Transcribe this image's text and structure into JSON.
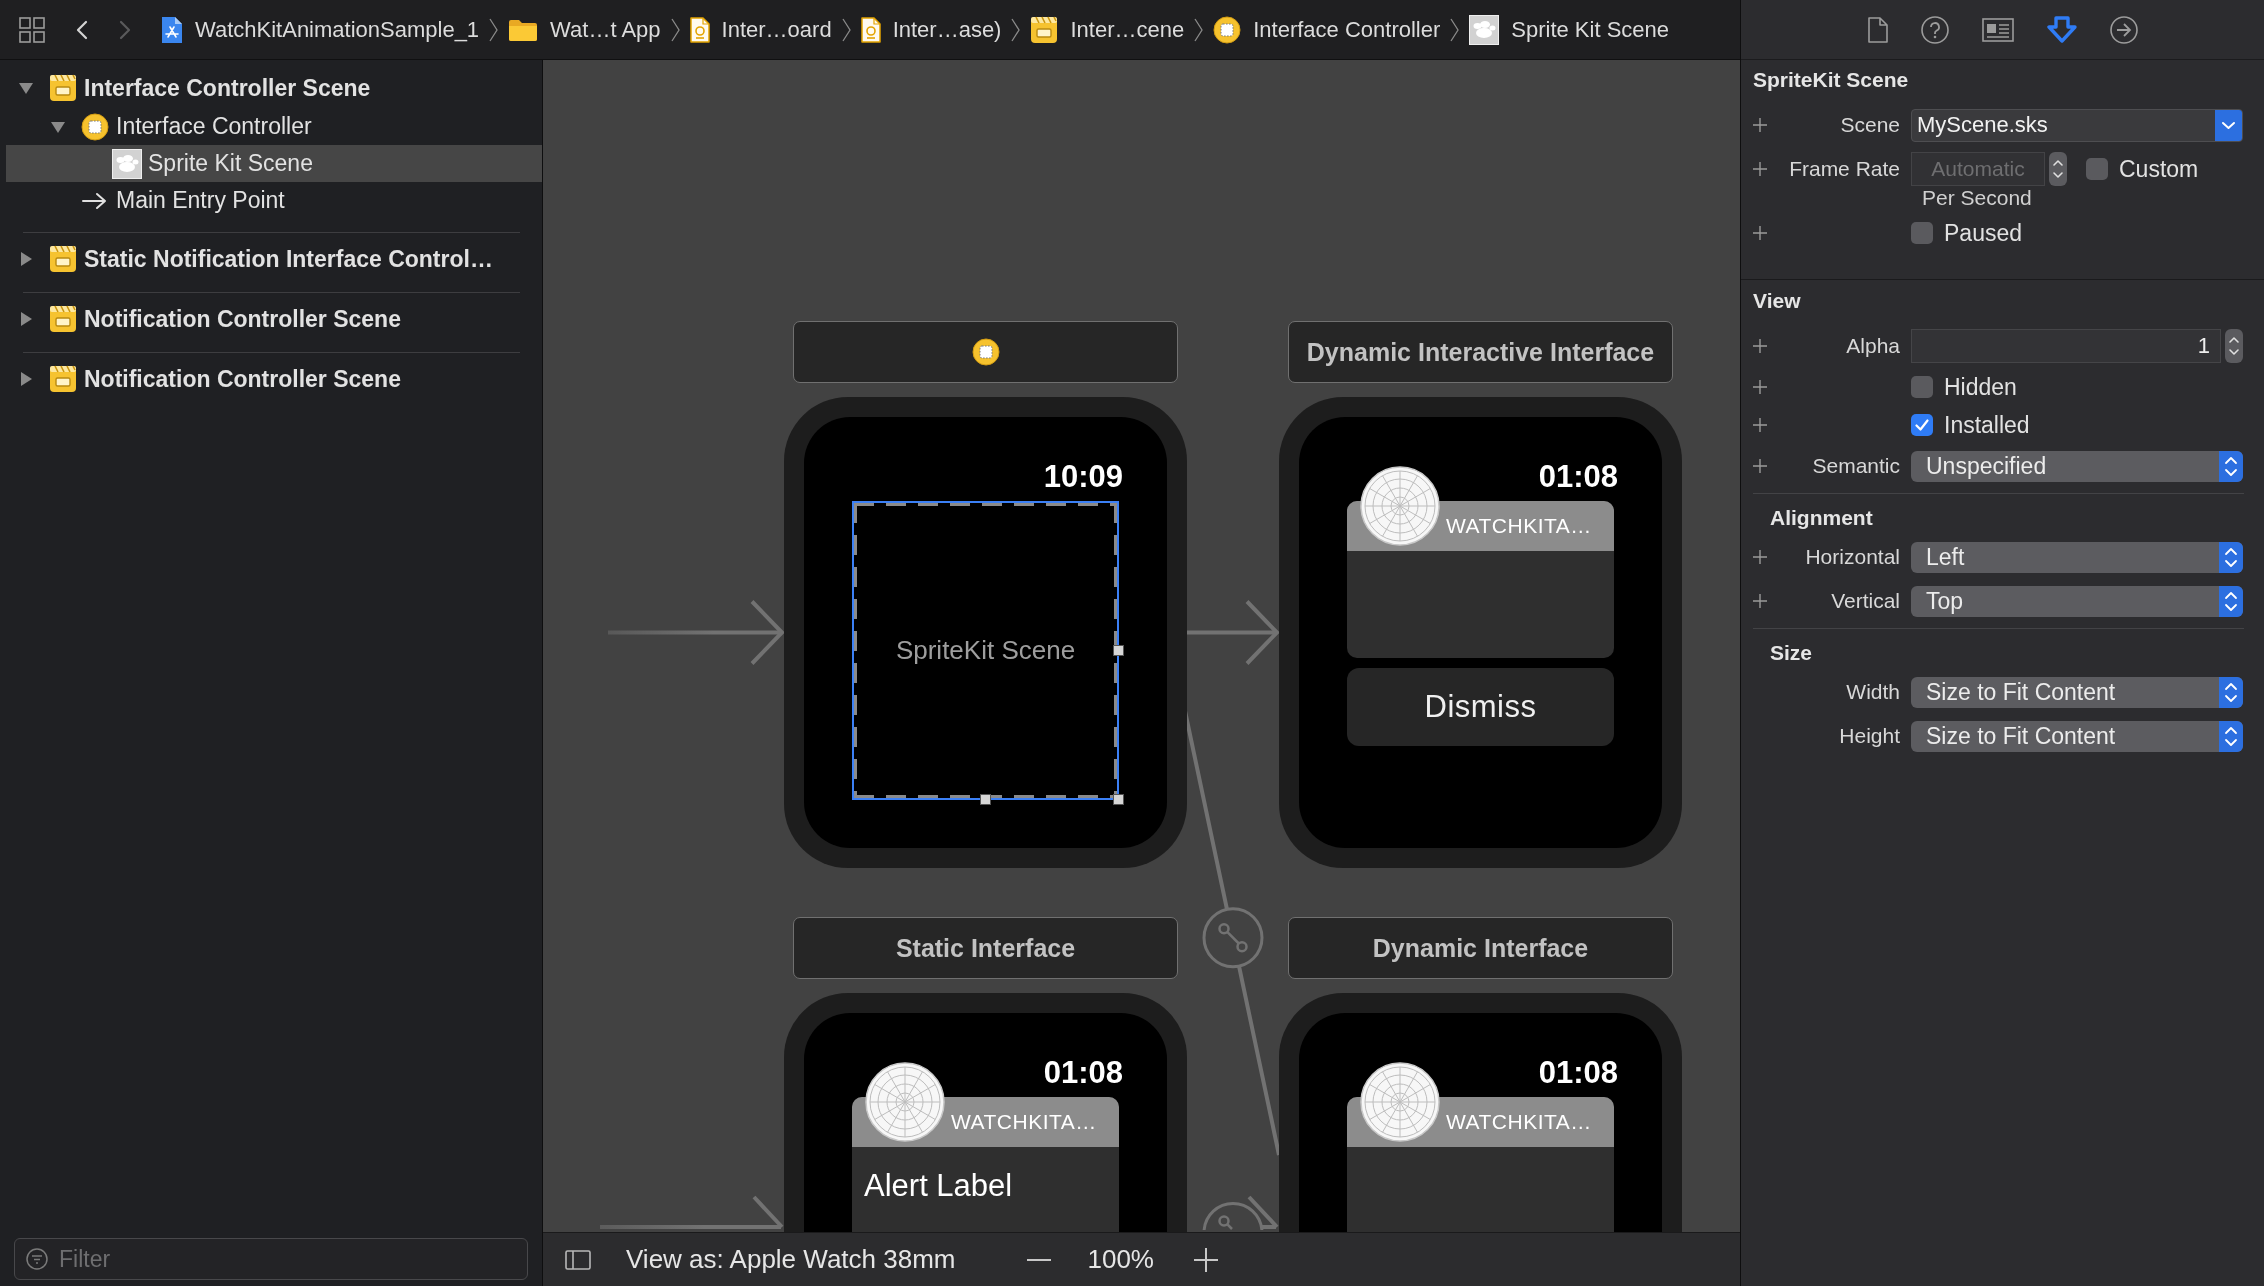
{
  "toolbar": {
    "history": [
      {
        "kind": "back",
        "disabled": false
      },
      {
        "kind": "forward",
        "disabled": true
      }
    ],
    "breadcrumbs": [
      {
        "kind": "project",
        "label": "WatchKitAnimationSample_1"
      },
      {
        "kind": "folder",
        "label": "Wat…t App"
      },
      {
        "kind": "storyboard",
        "label": "Inter…oard"
      },
      {
        "kind": "storyboard",
        "label": "Inter…ase)"
      },
      {
        "kind": "scene",
        "label": "Inter…cene"
      },
      {
        "kind": "controller",
        "label": "Interface Controller"
      },
      {
        "kind": "sprite",
        "label": "Sprite Kit Scene"
      }
    ]
  },
  "navigator": {
    "outline": [
      {
        "kind": "scene",
        "label": "Interface Controller Scene",
        "expanded": true,
        "selected": false,
        "children": [
          {
            "kind": "controller",
            "label": "Interface Controller",
            "expanded": true,
            "selected": false,
            "children": [
              {
                "kind": "sprite",
                "label": "Sprite Kit Scene",
                "selected": true
              }
            ]
          },
          {
            "kind": "entry",
            "label": "Main Entry Point",
            "selected": false
          }
        ]
      },
      {
        "kind": "scene",
        "label": "Static Notification Interface Control…",
        "expanded": false,
        "selected": false
      },
      {
        "kind": "scene",
        "label": "Notification Controller Scene",
        "expanded": false,
        "selected": false
      },
      {
        "kind": "scene",
        "label": "Notification Controller Scene",
        "expanded": false,
        "selected": false
      }
    ],
    "filter": {
      "placeholder": "Filter"
    }
  },
  "canvas": {
    "scenes": [
      {
        "kind": "sprite",
        "time": "10:09",
        "content_label": "SpriteKit Scene",
        "selected": true
      },
      {
        "kind": "notification",
        "title": "Dynamic Interactive Interface",
        "time": "01:08",
        "app_name": "WATCHKITA…",
        "button": "Dismiss"
      },
      {
        "kind": "notification",
        "title": "Static Interface",
        "time": "01:08",
        "app_name": "WATCHKITA…",
        "body": "Alert Label"
      },
      {
        "kind": "notification",
        "title": "Dynamic Interface",
        "time": "01:08",
        "app_name": "WATCHKITA…"
      }
    ],
    "bottom_bar": {
      "device_label": "View as: Apple Watch 38mm",
      "zoom": "100%"
    }
  },
  "inspector": {
    "tabs": [
      {
        "kind": "file",
        "selected": false
      },
      {
        "kind": "help",
        "selected": false
      },
      {
        "kind": "identity",
        "selected": false
      },
      {
        "kind": "attributes",
        "selected": true
      },
      {
        "kind": "connections",
        "selected": false
      }
    ],
    "sections": [
      {
        "title": "SpriteKit Scene",
        "rows": [
          {
            "kind": "combo",
            "addable": true,
            "label": "Scene",
            "value": "MyScene.sks"
          },
          {
            "kind": "stepper_field",
            "addable": true,
            "label": "Frame Rate",
            "placeholder": "Automatic",
            "disabled": true,
            "note": "Per Second",
            "checkbox": {
              "label": "Custom",
              "checked": false
            }
          },
          {
            "kind": "checkbox",
            "addable": true,
            "label": "Paused",
            "checked": false
          }
        ]
      },
      {
        "title": "View",
        "rows": [
          {
            "kind": "number",
            "addable": true,
            "label": "Alpha",
            "value": "1"
          },
          {
            "kind": "checkbox",
            "addable": true,
            "label": "Hidden",
            "checked": false
          },
          {
            "kind": "checkbox",
            "addable": true,
            "label": "Installed",
            "checked": true
          },
          {
            "kind": "popup",
            "addable": true,
            "label": "Semantic",
            "value": "Unspecified"
          }
        ],
        "groups": [
          {
            "title": "Alignment",
            "rows": [
              {
                "kind": "popup",
                "addable": true,
                "label": "Horizontal",
                "value": "Left"
              },
              {
                "kind": "popup",
                "addable": true,
                "label": "Vertical",
                "value": "Top"
              }
            ]
          },
          {
            "title": "Size",
            "rows": [
              {
                "kind": "popup",
                "addable": false,
                "label": "Width",
                "value": "Size to Fit Content"
              },
              {
                "kind": "popup",
                "addable": false,
                "label": "Height",
                "value": "Size to Fit Content"
              }
            ]
          }
        ]
      }
    ]
  }
}
